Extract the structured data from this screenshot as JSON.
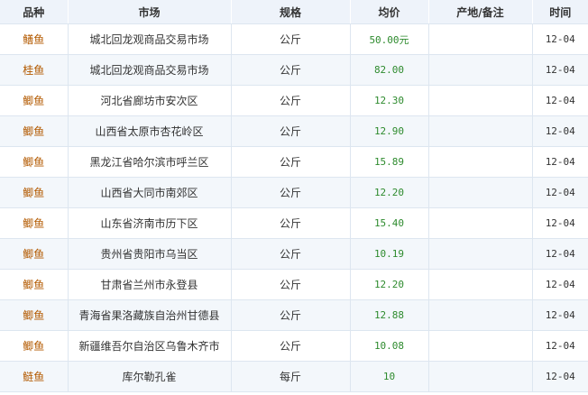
{
  "table": {
    "headers": [
      "品种",
      "市场",
      "规格",
      "均价",
      "产地/备注",
      "时间"
    ],
    "rows": [
      {
        "variety": "鳝鱼",
        "market": "城北回龙观商品交易市场",
        "spec": "公斤",
        "price": "50.00元",
        "origin": "",
        "date": "12-04"
      },
      {
        "variety": "桂鱼",
        "market": "城北回龙观商品交易市场",
        "spec": "公斤",
        "price": "82.00",
        "origin": "",
        "date": "12-04"
      },
      {
        "variety": "鲫鱼",
        "market": "河北省廊坊市安次区",
        "spec": "公斤",
        "price": "12.30",
        "origin": "",
        "date": "12-04"
      },
      {
        "variety": "鲫鱼",
        "market": "山西省太原市杏花岭区",
        "spec": "公斤",
        "price": "12.90",
        "origin": "",
        "date": "12-04"
      },
      {
        "variety": "鲫鱼",
        "market": "黑龙江省哈尔滨市呼兰区",
        "spec": "公斤",
        "price": "15.89",
        "origin": "",
        "date": "12-04"
      },
      {
        "variety": "鲫鱼",
        "market": "山西省大同市南郊区",
        "spec": "公斤",
        "price": "12.20",
        "origin": "",
        "date": "12-04"
      },
      {
        "variety": "鲫鱼",
        "market": "山东省济南市历下区",
        "spec": "公斤",
        "price": "15.40",
        "origin": "",
        "date": "12-04"
      },
      {
        "variety": "鲫鱼",
        "market": "贵州省贵阳市乌当区",
        "spec": "公斤",
        "price": "10.19",
        "origin": "",
        "date": "12-04"
      },
      {
        "variety": "鲫鱼",
        "market": "甘肃省兰州市永登县",
        "spec": "公斤",
        "price": "12.20",
        "origin": "",
        "date": "12-04"
      },
      {
        "variety": "鲫鱼",
        "market": "青海省果洛藏族自治州甘德县",
        "spec": "公斤",
        "price": "12.88",
        "origin": "",
        "date": "12-04"
      },
      {
        "variety": "鲫鱼",
        "market": "新疆维吾尔自治区乌鲁木齐市",
        "spec": "公斤",
        "price": "10.08",
        "origin": "",
        "date": "12-04"
      },
      {
        "variety": "鲢鱼",
        "market": "库尔勒孔雀",
        "spec": "每斤",
        "price": "10",
        "origin": "",
        "date": "12-04"
      }
    ]
  },
  "colors": {
    "header_bg": "#eef3fa",
    "alt_row_bg": "#f3f7fb",
    "variety_text": "#b35a00",
    "price_text": "#2e8b2e",
    "border": "#dde6f0"
  }
}
